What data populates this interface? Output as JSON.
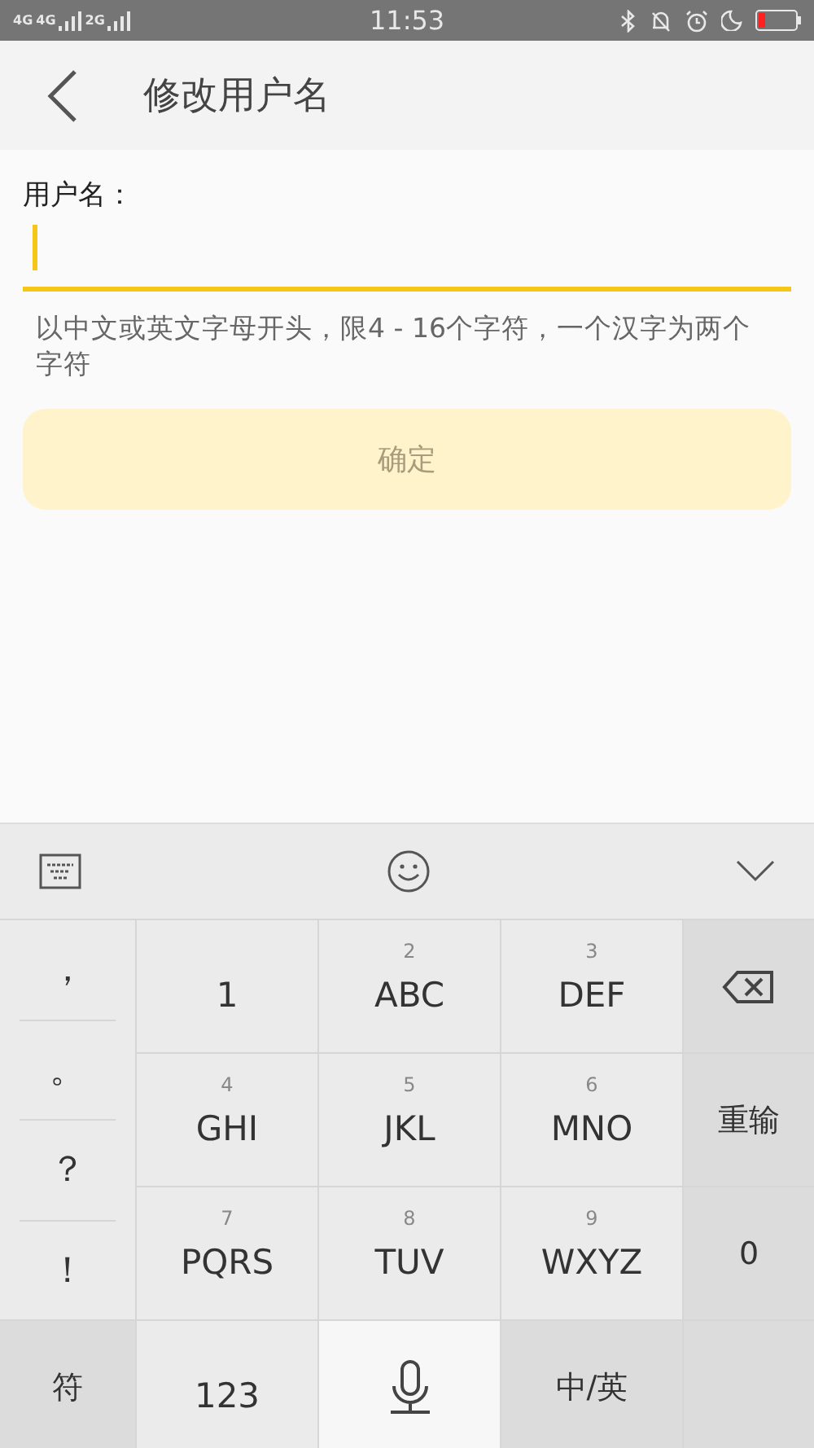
{
  "status_bar": {
    "networks": [
      "4G",
      "4G",
      "2G"
    ],
    "time": "11:53"
  },
  "header": {
    "title": "修改用户名"
  },
  "form": {
    "label": "用户名：",
    "hint": "以中文或英文字母开头，限4 - 16个字符，一个汉字为两个字符",
    "button": {
      "label": "确定",
      "disabled": true
    }
  },
  "keyboard": {
    "symbols": [
      "，",
      "。",
      "？",
      "！"
    ],
    "keys": [
      {
        "kind": "key",
        "label": "1"
      },
      {
        "kind": "key",
        "sub": "2",
        "label": "ABC"
      },
      {
        "kind": "key",
        "sub": "3",
        "label": "DEF"
      },
      {
        "kind": "backspace"
      },
      {
        "kind": "key",
        "sub": "4",
        "label": "GHI"
      },
      {
        "kind": "key",
        "sub": "5",
        "label": "JKL"
      },
      {
        "kind": "key",
        "sub": "6",
        "label": "MNO"
      },
      {
        "kind": "function",
        "label": "重输"
      },
      {
        "kind": "key",
        "sub": "7",
        "label": "PQRS"
      },
      {
        "kind": "key",
        "sub": "8",
        "label": "TUV"
      },
      {
        "kind": "key",
        "sub": "9",
        "label": "WXYZ"
      },
      {
        "kind": "function",
        "label": "0"
      },
      {
        "kind": "function",
        "label": "符"
      },
      {
        "kind": "key",
        "label": "123"
      },
      {
        "kind": "mic"
      },
      {
        "kind": "function",
        "label": "中/英"
      },
      {
        "kind": "function"
      }
    ]
  }
}
